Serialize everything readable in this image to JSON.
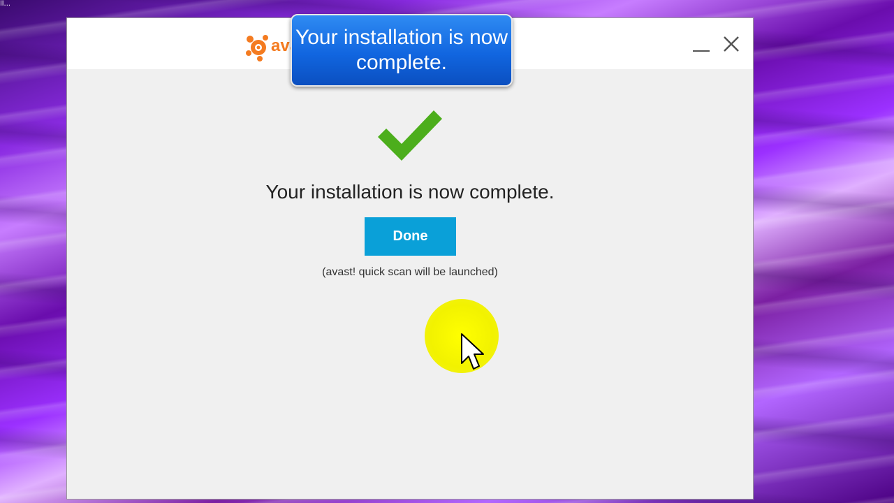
{
  "desktop": {
    "corner_label": "ll..."
  },
  "window": {
    "logo_text": "avast!",
    "minimize_icon": "minimize-icon",
    "close_icon": "close-icon"
  },
  "content": {
    "status_icon": "checkmark-icon",
    "headline": "Your installation is now complete.",
    "done_label": "Done",
    "note": "(avast! quick scan will be launched)"
  },
  "callout": {
    "text": "Your installation is now complete."
  },
  "colors": {
    "checkmark": "#4cae1c",
    "done_button": "#0aa0d8",
    "logo_orange": "#f47b20",
    "callout_blue": "#1166e0",
    "cursor_highlight": "#ffff00"
  }
}
